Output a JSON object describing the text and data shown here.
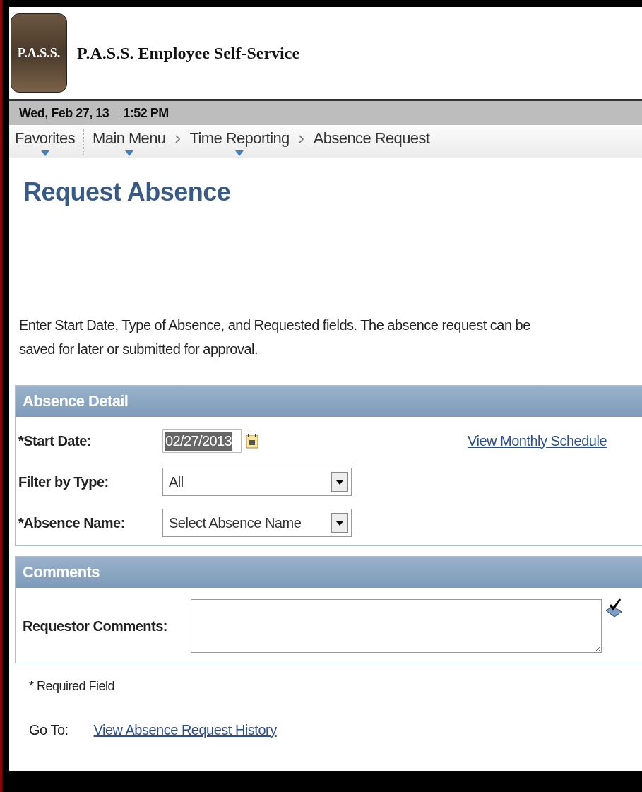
{
  "header": {
    "logo": "P.A.S.S.",
    "title": "P.A.S.S. Employee Self-Service"
  },
  "date_bar": {
    "date": "Wed, Feb 27, 13",
    "time": "1:52 PM"
  },
  "breadcrumbs": [
    {
      "label": "Favorites",
      "dropdown": true
    },
    {
      "label": "Main Menu",
      "dropdown": true
    },
    {
      "label": "Time Reporting",
      "dropdown": true
    },
    {
      "label": "Absence Request",
      "dropdown": false
    }
  ],
  "page_title": "Request Absence",
  "instructions": "Enter Start Date, Type of Absence, and Requested fields. The absence request can be saved for later or submitted for approval.",
  "absence_detail": {
    "title": "Absence Detail",
    "link": "View Monthly Schedule",
    "fields": [
      {
        "kind": "date",
        "label": "*Start Date:",
        "value": "02/27/2013",
        "highlighted": true
      },
      {
        "kind": "select",
        "label": "Filter by Type:",
        "value": "All"
      },
      {
        "kind": "select",
        "label": "*Absence Name:",
        "value": "Select Absence Name"
      }
    ]
  },
  "comments": {
    "title": "Comments",
    "label": "Requestor Comments:"
  },
  "required_note": "* Required Field",
  "go_to": {
    "label": "Go To:",
    "link": "View Absence Request History"
  }
}
